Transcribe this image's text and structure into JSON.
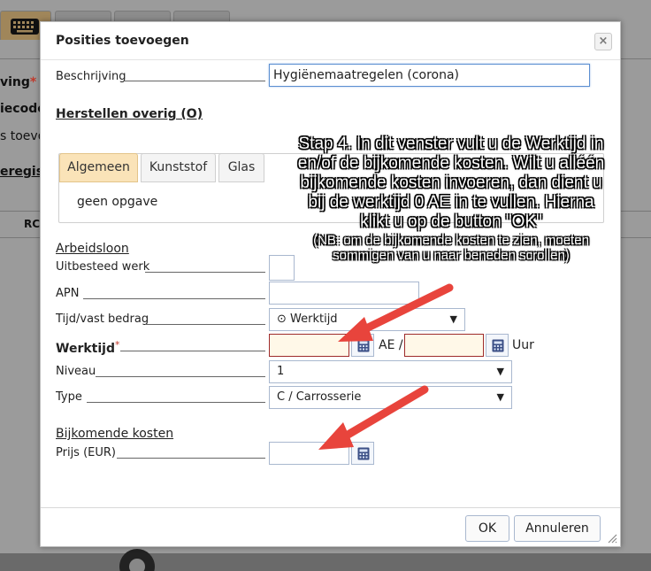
{
  "background": {
    "labels": [
      "ving",
      "iecode",
      "s toevo",
      "eregist",
      "RC"
    ]
  },
  "dialog": {
    "title": "Posities toevoegen",
    "close_symbol": "×",
    "beschrijving_label": "Beschrijving",
    "beschrijving_value": "Hygiënemaatregelen (corona)",
    "herstellen_link": "Herstellen overig (O)",
    "tabs": [
      {
        "label": "Algemeen",
        "active": true
      },
      {
        "label": "Kunststof",
        "active": false
      },
      {
        "label": "Glas",
        "active": false
      }
    ],
    "tab_content": "geen opgave",
    "arbeidsloon": {
      "title": "Arbeidsloon",
      "uitbesteed_label": "Uitbesteed werk",
      "apn_label": "APN",
      "apn_value": "",
      "tijd_label": "Tijd/vast bedrag",
      "tijd_value": "⊙ Werktijd",
      "werktijd_label": "Werktijd",
      "werktijd_required": "*",
      "werktijd_value": "",
      "ae_label": "AE /",
      "uur_value": "",
      "uur_label": "Uur",
      "niveau_label": "Niveau",
      "niveau_value": "1",
      "type_label": "Type",
      "type_value": "C / Carrosserie"
    },
    "bijkomende": {
      "title": "Bijkomende kosten",
      "prijs_label": "Prijs (EUR)",
      "prijs_value": ""
    },
    "ok_label": "OK",
    "annuleren_label": "Annuleren"
  },
  "annotation": {
    "main": "Stap 4. In dit venster vult u de Werktijd in en/of de bijkomende kosten. Wilt u alléén bijkomende kosten invoeren, dan dient u bij de werktijd 0 AE in te vullen. Hierna klikt u op de button \"OK\"",
    "note": "(NB: om de bijkomende kosten te zien, moeten sommigen van u naar beneden scrollen)"
  },
  "colors": {
    "tab_active": "#fae3b8",
    "required_border": "#9e2b2b",
    "arrow": "#e8443c"
  }
}
